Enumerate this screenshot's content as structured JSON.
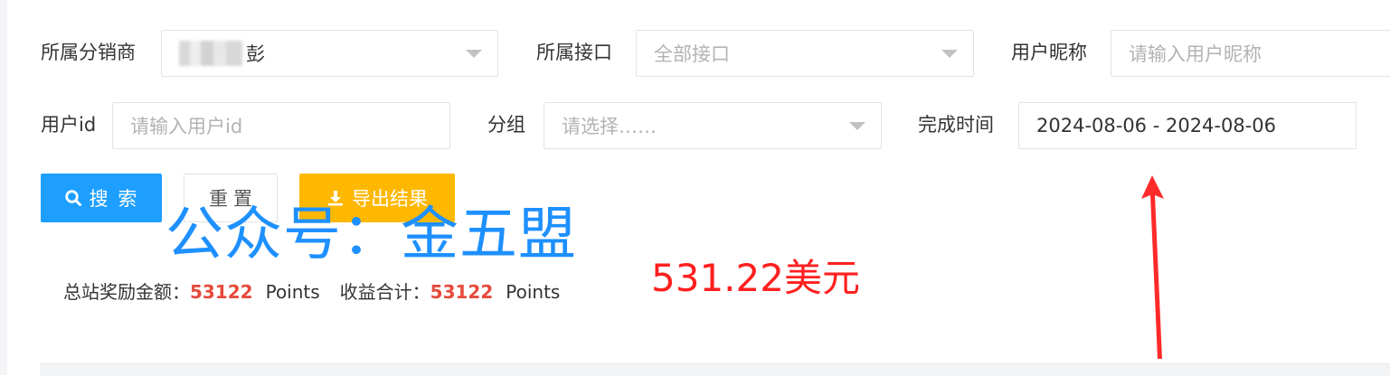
{
  "filters": {
    "distributor": {
      "label": "所属分销商",
      "value": "彭"
    },
    "interface": {
      "label": "所属接口",
      "placeholder": "全部接口"
    },
    "nickname": {
      "label": "用户昵称",
      "placeholder": "请输入用户昵称"
    },
    "user_id": {
      "label": "用户id",
      "placeholder": "请输入用户id"
    },
    "group": {
      "label": "分组",
      "placeholder": "请选择……"
    },
    "finish_time": {
      "label": "完成时间",
      "value": "2024-08-06 - 2024-08-06"
    }
  },
  "buttons": {
    "search": "搜 索",
    "reset": "重置",
    "export": "导出结果"
  },
  "annotation": {
    "watermark": "公众号：金五盟",
    "usd_note": "531.22美元",
    "arrow_color": "#ff2a2a"
  },
  "summary": {
    "total_reward_label": "总站奖励金额：",
    "total_reward_value": "53122",
    "total_reward_unit": "Points",
    "income_label": "收益合计：",
    "income_value": "53122",
    "income_unit": "Points"
  },
  "colors": {
    "primary": "#1e9fff",
    "warning": "#ffb800",
    "amount": "#e64a3b"
  }
}
